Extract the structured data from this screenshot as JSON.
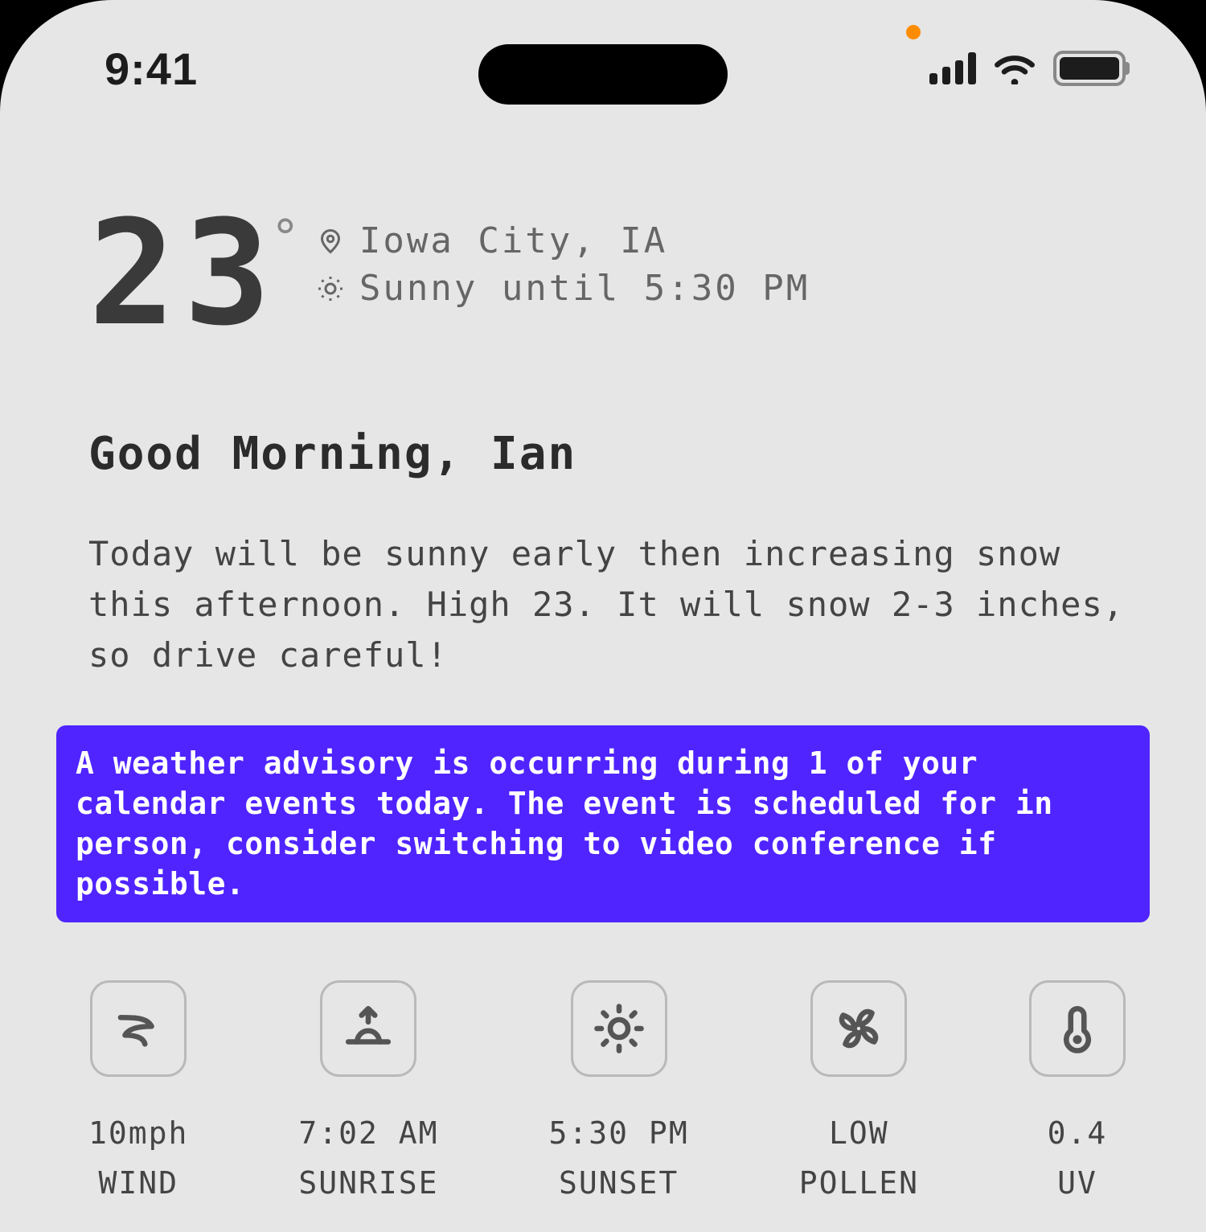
{
  "status": {
    "time": "9:41"
  },
  "hero": {
    "temp": "23",
    "deg": "°",
    "location": "Iowa City, IA",
    "condition": "Sunny until 5:30 PM"
  },
  "greeting": "Good Morning, Ian",
  "summary": "Today will be sunny early then increasing snow this afternoon. High 23. It will snow 2-3 inches, so drive careful!",
  "advisory": "A weather advisory is occurring during 1 of your calendar events today. The event is scheduled for in person, consider switching to video conference if possible.",
  "stats": [
    {
      "icon": "wind-icon",
      "value": "10mph",
      "label": "WIND"
    },
    {
      "icon": "sunrise-icon",
      "value": "7:02 AM",
      "label": "SUNRISE"
    },
    {
      "icon": "sun-icon",
      "value": "5:30 PM",
      "label": "SUNSET"
    },
    {
      "icon": "fan-icon",
      "value": "LOW",
      "label": "POLLEN"
    },
    {
      "icon": "thermo-icon",
      "value": "0.4",
      "label": "UV"
    }
  ]
}
